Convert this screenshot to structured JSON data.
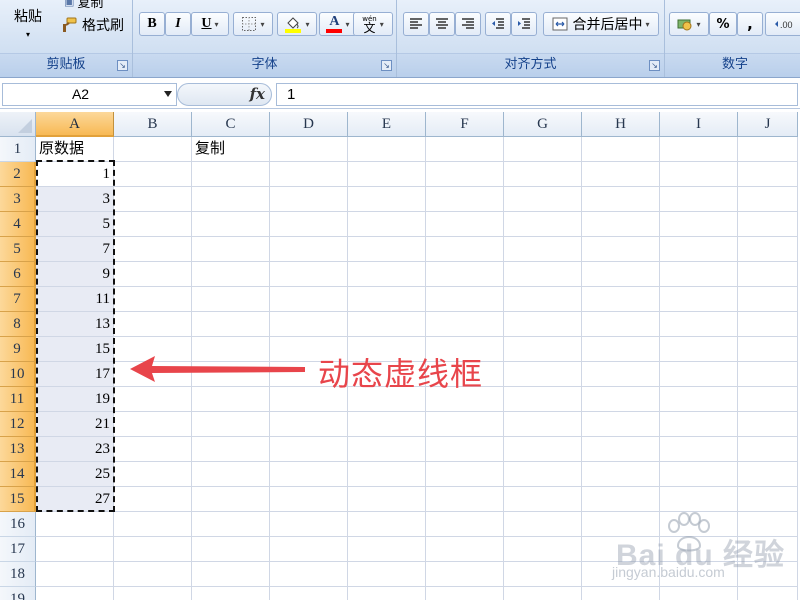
{
  "ribbon": {
    "clipboard": {
      "paste_label": "粘贴",
      "copy_label": "复制",
      "format_painter_label": "格式刷",
      "group_label": "剪贴板"
    },
    "font": {
      "bold": "B",
      "italic": "I",
      "underline": "U",
      "font_color_glyph": "A",
      "phonetic_top": "wén",
      "phonetic_glyph": "文",
      "group_label": "字体",
      "fill_color": "#ffff00",
      "font_color": "#ff0000"
    },
    "alignment": {
      "merge_center_label": "合并后居中",
      "group_label": "对齐方式"
    },
    "number": {
      "percent_label": "%",
      "comma_label": ",",
      "group_label": "数字"
    }
  },
  "formula_bar": {
    "name_box": "A2",
    "fx_label": "fx",
    "formula_value": "1"
  },
  "sheet": {
    "columns": [
      "A",
      "B",
      "C",
      "D",
      "E",
      "F",
      "G",
      "H",
      "I",
      "J"
    ],
    "selected_column": "A",
    "rows": [
      "1",
      "2",
      "3",
      "4",
      "5",
      "6",
      "7",
      "8",
      "9",
      "10",
      "11",
      "12",
      "13",
      "14",
      "15",
      "16",
      "17",
      "18",
      "19"
    ],
    "selected_rows": [
      "2",
      "3",
      "4",
      "5",
      "6",
      "7",
      "8",
      "9",
      "10",
      "11",
      "12",
      "13",
      "14",
      "15"
    ],
    "a1": "原数据",
    "c1": "复制",
    "a_values": [
      "1",
      "3",
      "5",
      "7",
      "9",
      "11",
      "13",
      "15",
      "17",
      "19",
      "21",
      "23",
      "25",
      "27"
    ]
  },
  "annotation": {
    "text": "动态虚线框",
    "color": "#e8454b"
  },
  "watermark": {
    "brand": "Bai du 经验",
    "url": "jingyan.baidu.com"
  }
}
